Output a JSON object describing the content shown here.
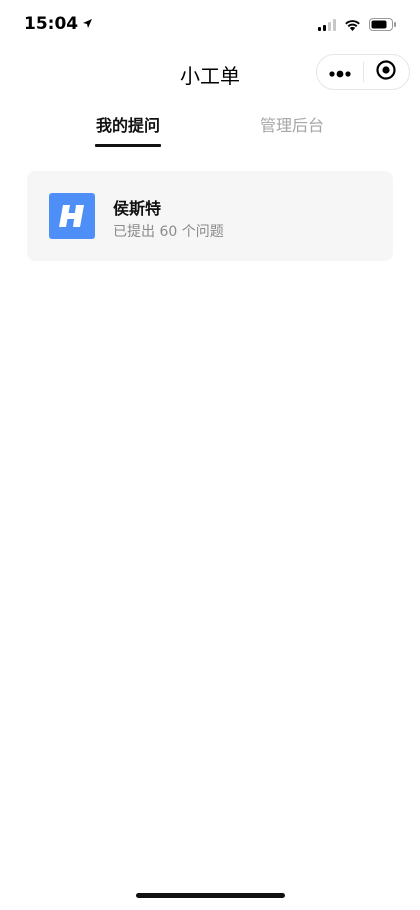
{
  "status_bar": {
    "time": "15:04",
    "icons": [
      "location-arrow-icon",
      "cellular-signal-icon",
      "wifi-icon",
      "battery-icon"
    ]
  },
  "nav": {
    "title": "小工单",
    "capsule": [
      "more-icon",
      "close-mini-program-icon"
    ]
  },
  "tabs": [
    {
      "label": "我的提问",
      "active": true
    },
    {
      "label": "管理后台",
      "active": false
    }
  ],
  "card": {
    "title": "侯斯特",
    "subtitle": "已提出 60 个问题",
    "avatar_icon": "h-logo-icon",
    "avatar_color": "#4d8ff7"
  }
}
